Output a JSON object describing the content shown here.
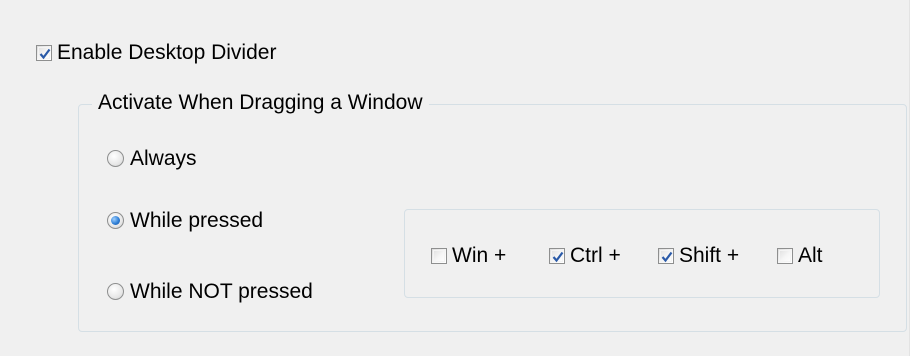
{
  "enable_checkbox": {
    "label": "Enable Desktop Divider",
    "checked": true
  },
  "group": {
    "title": "Activate When Dragging a Window",
    "options": [
      {
        "label": "Always",
        "selected": false
      },
      {
        "label": "While pressed",
        "selected": true
      },
      {
        "label": "While NOT pressed",
        "selected": false
      }
    ]
  },
  "modifiers": [
    {
      "label": "Win +",
      "checked": false
    },
    {
      "label": "Ctrl +",
      "checked": true
    },
    {
      "label": "Shift +",
      "checked": true
    },
    {
      "label": "Alt",
      "checked": false
    }
  ],
  "colors": {
    "panel_bg": "#f0f0f0",
    "border": "#d5dfe5",
    "check": "#2a5aa8",
    "radio_dot": "#2f7fd6"
  }
}
